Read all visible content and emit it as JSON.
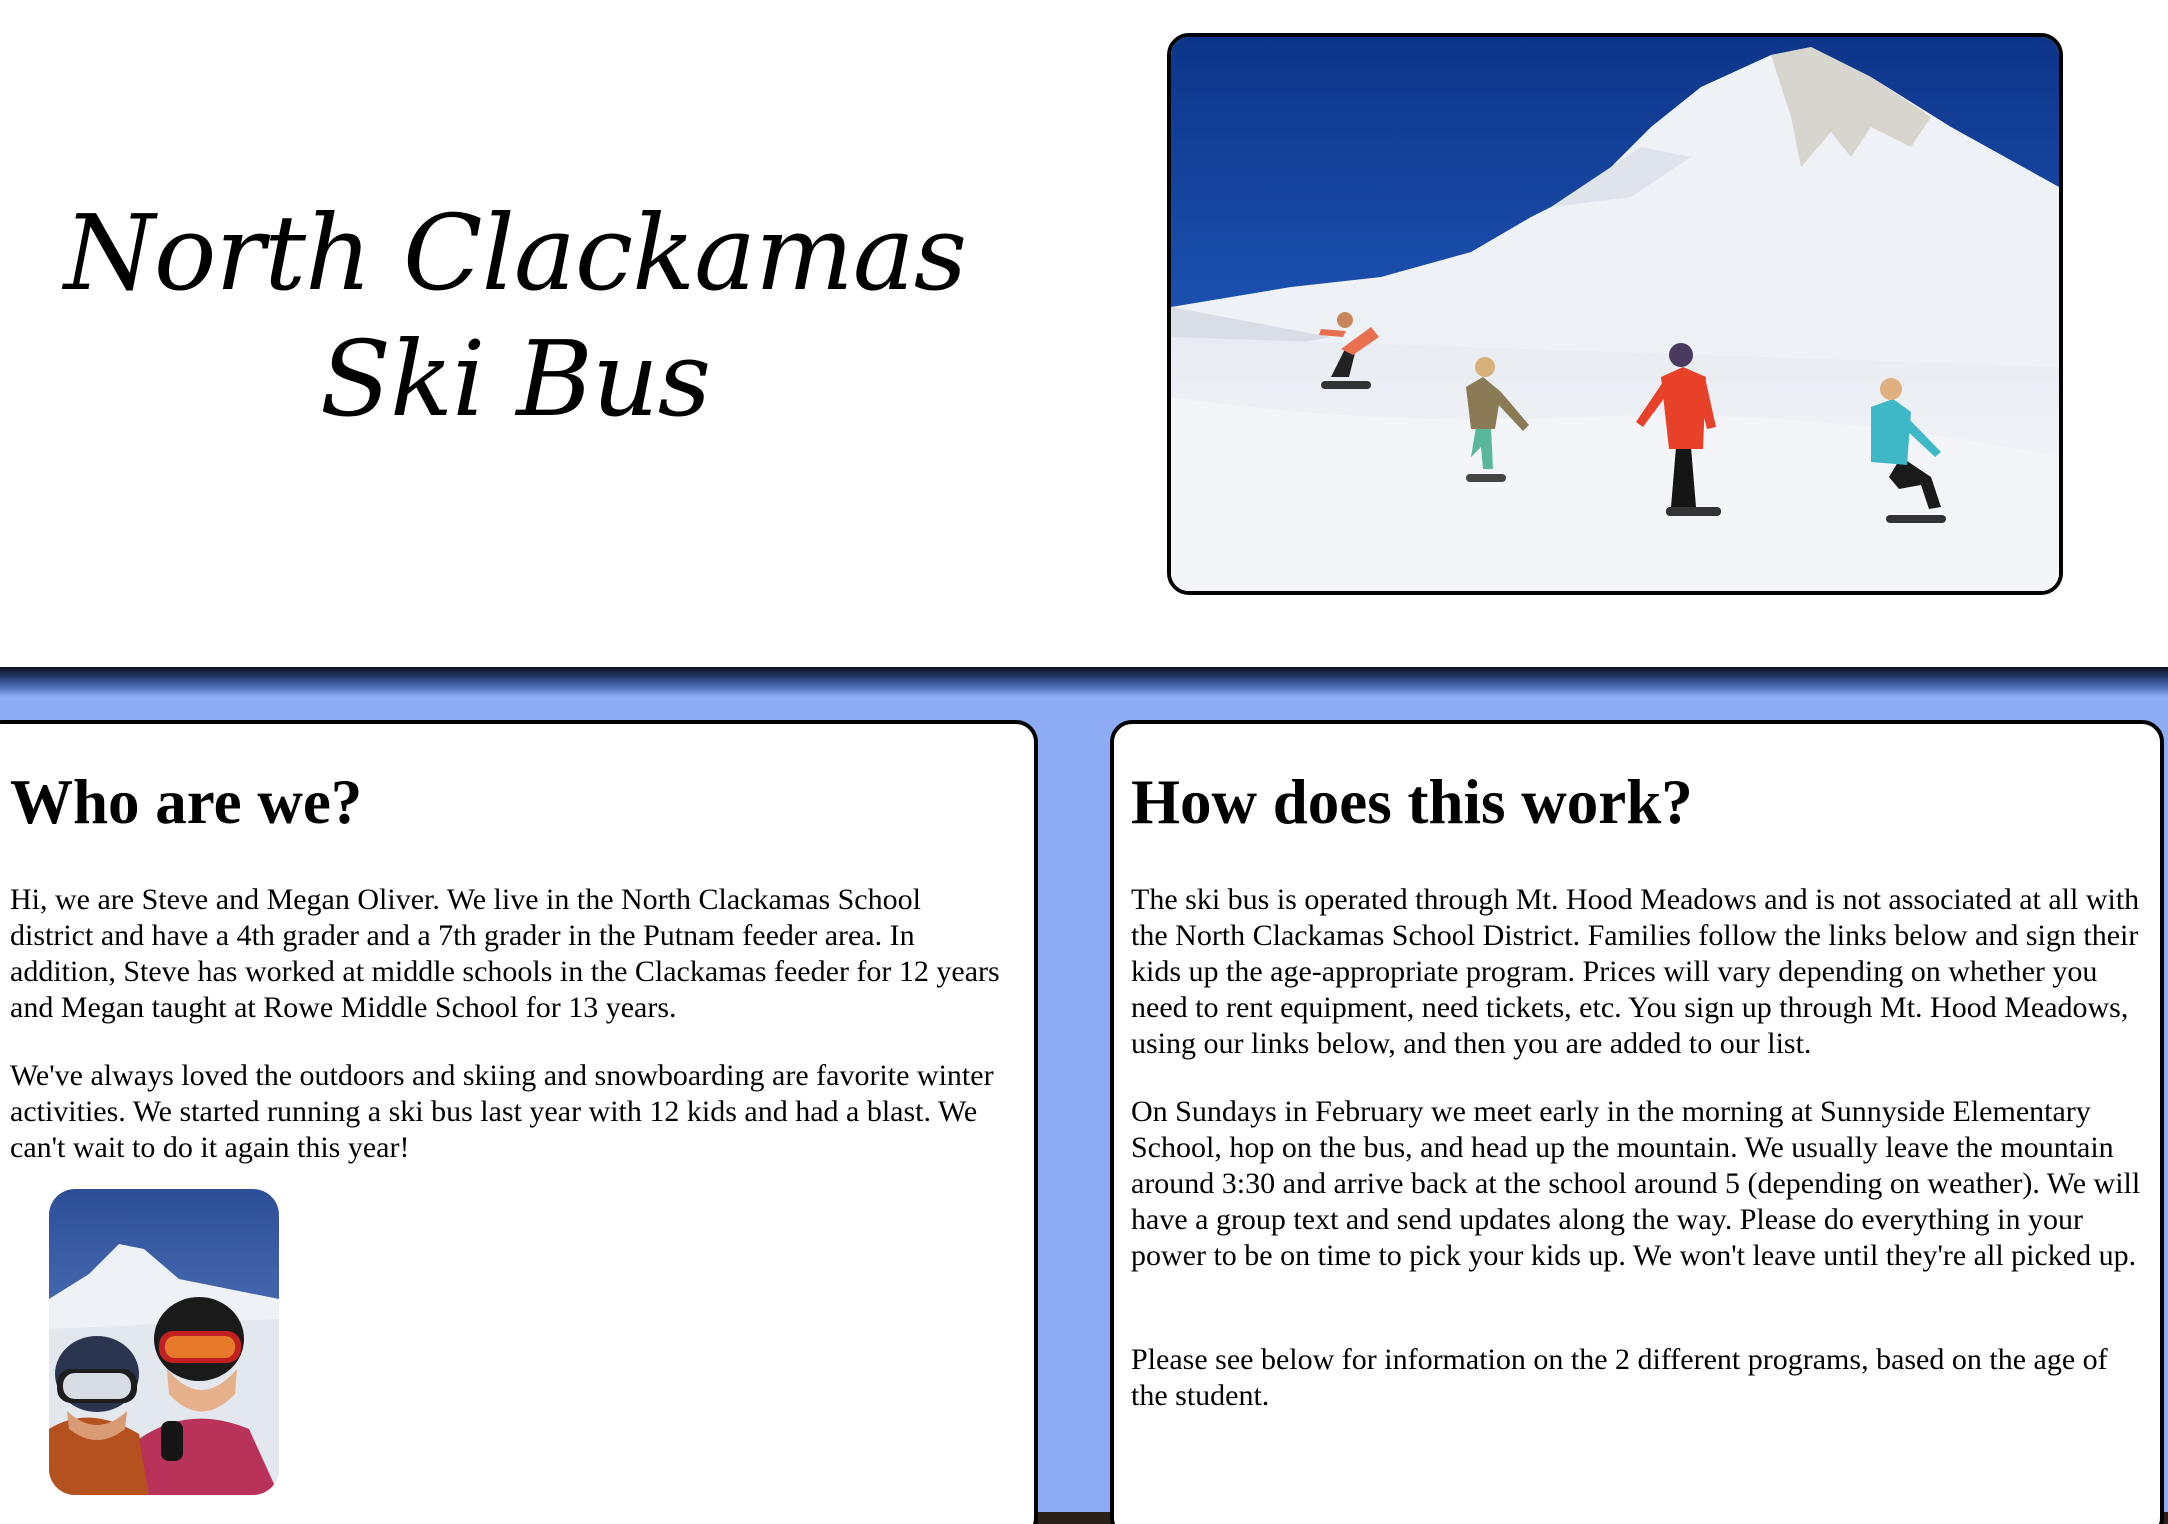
{
  "header": {
    "title_line1": "North Clackamas",
    "title_line2": "Ski Bus"
  },
  "hero_image": {
    "icon": "snowboarders-on-mountain-photo"
  },
  "who_section": {
    "heading": "Who are we?",
    "paragraphs": [
      "Hi, we are Steve and Megan Oliver. We live in the North Clackamas School district and have a 4th grader and a 7th grader in the Putnam feeder area. In addition, Steve has worked at middle schools in the Clackamas feeder for 12 years and Megan taught at Rowe Middle School for 13 years.",
      "We've always loved the outdoors and skiing and snowboarding are favorite winter activities. We started running a ski bus last year with 12 kids and had a blast. We can't wait to do it again this year!"
    ],
    "photo": {
      "icon": "family-skiers-selfie-photo"
    }
  },
  "how_section": {
    "heading": "How does this work?",
    "paragraphs": [
      "The ski bus is operated through Mt. Hood Meadows and is not associated at all with the North Clackamas School District. Families follow the links below and sign their kids up the age-appropriate program. Prices will vary depending on whether you need to rent equipment, need tickets, etc. You sign up through Mt. Hood Meadows, using our links below, and then you are added to our list.",
      "On Sundays in February we meet early in the morning at Sunnyside Elementary School, hop on the bus, and head up the mountain. We usually leave the mountain around 3:30 and arrive back at the school around 5 (depending on weather). We will have a group text and send updates along the way. Please do everything in your power to be on time to pick your kids up. We won't leave until they're all picked up.",
      "Please see below for information on the 2 different programs, based on the age of the student."
    ]
  },
  "colors": {
    "band_background": "#8eacf4",
    "panel_background": "#ffffff",
    "border": "#000000"
  }
}
